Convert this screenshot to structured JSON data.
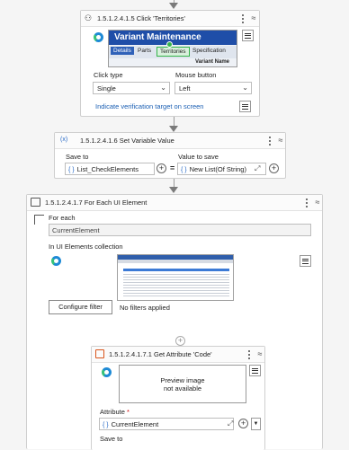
{
  "card1": {
    "title": "1.5.1.2.4.1.5  Click 'Territories'",
    "preview": {
      "form_title": "Variant Maintenance",
      "tabs": [
        "Details",
        "Parts",
        "Territories",
        "Specification"
      ],
      "variant_name_label": "Variant Name"
    },
    "click_type_label": "Click type",
    "click_type_value": "Single",
    "mouse_button_label": "Mouse button",
    "mouse_button_value": "Left",
    "indicate_link": "Indicate verification target on screen"
  },
  "card2": {
    "title": "1.5.1.2.4.1.6  Set Variable Value",
    "save_to_label": "Save to",
    "save_to_value": "List_CheckElements",
    "value_to_save_label": "Value to save",
    "value_to_save_value": "New List(Of String)",
    "equals": "="
  },
  "card3": {
    "title": "1.5.1.2.4.1.7  For Each UI Element",
    "for_each_label": "For each",
    "for_each_value": "CurrentElement",
    "collection_label": "In UI Elements collection",
    "configure_filter_label": "Configure filter",
    "filter_status": "No filters applied"
  },
  "card4": {
    "title": "1.5.1.2.4.1.7.1  Get Attribute 'Code'",
    "preview_line1": "Preview image",
    "preview_line2": "not available",
    "attribute_label": "Attribute",
    "attribute_required": "*",
    "attribute_value": "CurrentElement",
    "save_to_label": "Save to"
  },
  "icons": {
    "vb_badge": "{ }",
    "plus": "+",
    "chevron": "⌄",
    "collapse": "≈",
    "expand": "⤢"
  },
  "colors": {
    "accent": "#1e6fd0",
    "link": "#1b5fb3",
    "preview_header": "#1f4ea8"
  }
}
